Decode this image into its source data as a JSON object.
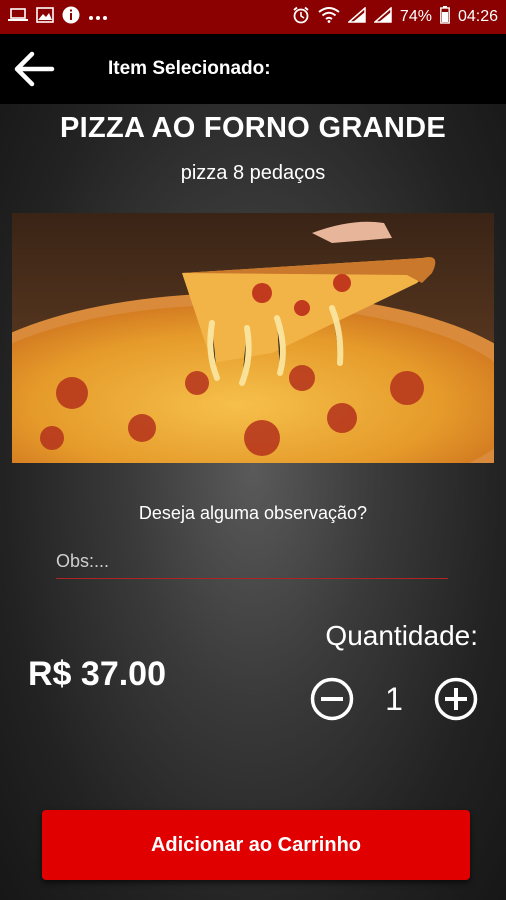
{
  "status_bar": {
    "left_icons": [
      "laptop-icon",
      "image-icon",
      "info-icon",
      "more-dots-icon"
    ],
    "right_icons": [
      "alarm-icon",
      "wifi-icon",
      "signal-icon",
      "signal-icon"
    ],
    "battery": "74%",
    "time": "04:26",
    "color": "#8b0000"
  },
  "app_bar": {
    "back_icon": "arrow-left-icon",
    "title": "Item Selecionado:"
  },
  "item": {
    "title": "PIZZA AO FORNO GRANDE",
    "subtitle": "pizza 8 pedaços",
    "image": "pizza-photo"
  },
  "observation": {
    "question": "Deseja alguma observação?",
    "placeholder": "Obs:...",
    "value": ""
  },
  "price": "R$ 37.00",
  "quantity": {
    "label": "Quantidade:",
    "value": "1",
    "decrement_icon": "minus-circle-icon",
    "increment_icon": "plus-circle-icon"
  },
  "add_button": {
    "label": "Adicionar ao Carrinho",
    "color": "#e00000"
  }
}
